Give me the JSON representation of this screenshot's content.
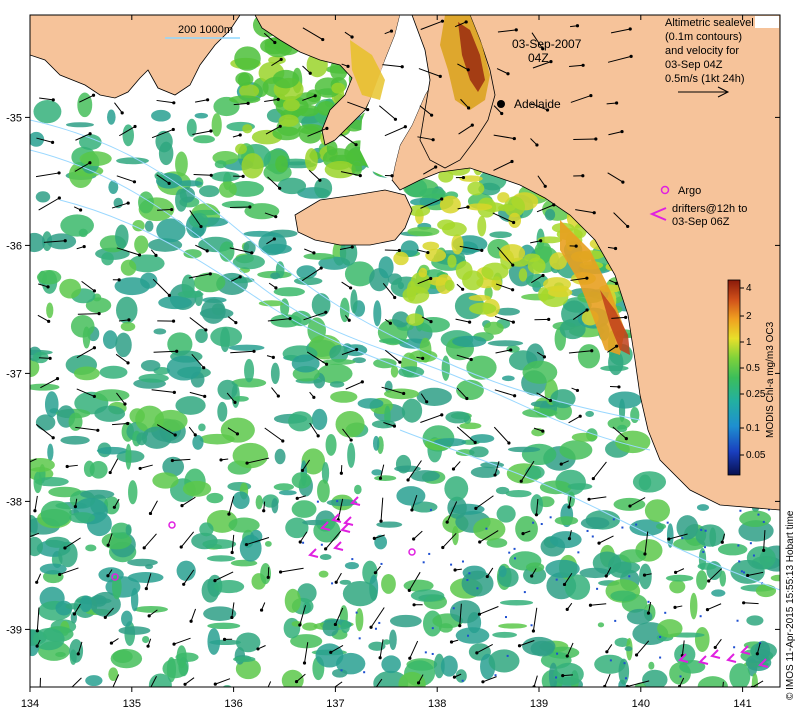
{
  "colors": {
    "land": "#f6c39a",
    "ocean_blank": "#ffffff",
    "chl_low": "#2fa77f",
    "chl_mid": "#4cc04a",
    "chl_high": "#f2d21b",
    "chl_peak": "#a0220f",
    "argo": "#e020e0",
    "drifter": "#e020e0",
    "contour": "#9ad8ff"
  },
  "scale_bar": {
    "label": "200  1000m"
  },
  "date": {
    "line1": "03-Sep-2007",
    "line2": "04Z"
  },
  "legend": {
    "lines": [
      "Altimetric sealevel",
      "(0.1m contours)",
      "and velocity for",
      "03-Sep 04Z",
      "0.5m/s (1kt 24h)"
    ]
  },
  "city": {
    "name": "Adelaide"
  },
  "argo": {
    "label": "Argo"
  },
  "drifters": {
    "line1": "drifters@12h to",
    "line2": "03-Sep 06Z"
  },
  "colorbar": {
    "title": "MODIS Chl-a mg/m3 OC3",
    "ticks": [
      "4",
      "2",
      "1",
      "0.5",
      "0.25",
      "0.1",
      "0.05"
    ]
  },
  "credit": "© IMOS 11-Apr-2015 15:55:13 Hobart time",
  "axes": {
    "x_ticks": [
      "134",
      "135",
      "136",
      "137",
      "138",
      "139",
      "140",
      "141"
    ],
    "y_ticks": [
      "-35",
      "-36",
      "-37",
      "-38",
      "-39"
    ]
  }
}
